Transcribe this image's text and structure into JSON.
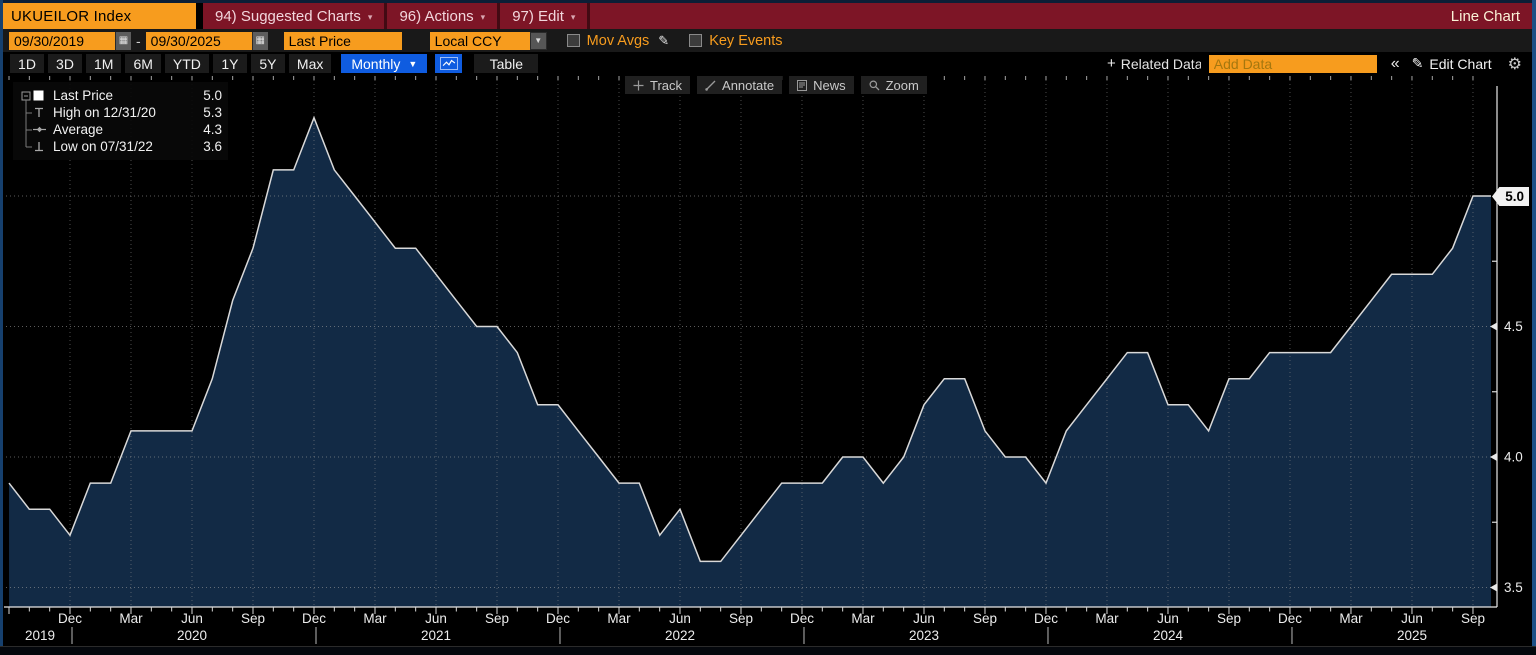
{
  "titlebar": {
    "ticker": "UKUEILOR Index",
    "menus": [
      {
        "label": "94) Suggested Charts"
      },
      {
        "label": "96) Actions"
      },
      {
        "label": "97) Edit"
      }
    ],
    "view_label": "Line Chart"
  },
  "controls": {
    "date_from": "09/30/2019",
    "range_separator": "-",
    "date_to": "09/30/2025",
    "security_field": "Last Price",
    "currency": "Local CCY",
    "mov_avgs_label": "Mov Avgs",
    "key_events_label": "Key Events"
  },
  "toolbar": {
    "ranges": [
      "1D",
      "3D",
      "1M",
      "6M",
      "YTD",
      "1Y",
      "5Y",
      "Max"
    ],
    "period": "Monthly",
    "table_label": "Table",
    "related_data_label": "Related Data",
    "add_data_placeholder": "Add Data",
    "edit_chart_label": "Edit Chart"
  },
  "chart_toolbar": {
    "buttons": [
      {
        "label": "Track"
      },
      {
        "label": "Annotate"
      },
      {
        "label": "News"
      },
      {
        "label": "Zoom"
      }
    ]
  },
  "legend": {
    "rows": [
      {
        "marker": "square",
        "label": "Last Price",
        "value": "5.0"
      },
      {
        "marker": "high",
        "label": "High on 12/31/20",
        "value": "5.3"
      },
      {
        "marker": "average",
        "label": "Average",
        "value": "4.3"
      },
      {
        "marker": "low",
        "label": "Low on 07/31/22",
        "value": "3.6"
      }
    ]
  },
  "y_axis": {
    "last_price_flag": "5.0",
    "tick_labels": [
      "4.5",
      "4.0",
      "3.5"
    ]
  },
  "icons": {
    "caret_small": "▾",
    "caret_down": "▼",
    "calendar": "▦",
    "pencil": "✎",
    "plus": "+",
    "collapse": "«",
    "gear": "⚙"
  },
  "colors": {
    "accent_orange": "#f79c1e",
    "titlebar_red": "#7d1526",
    "selected_blue": "#0f5ce0",
    "chart_fill": "#122a45",
    "chart_line": "#d9d9d9"
  },
  "chart_data": {
    "type": "area",
    "series_name": "Last Price",
    "frequency": "monthly",
    "start": "2019-09",
    "end": "2025-09",
    "values": [
      3.9,
      3.8,
      3.8,
      3.7,
      3.9,
      3.9,
      4.1,
      4.1,
      4.1,
      4.1,
      4.3,
      4.6,
      4.8,
      5.1,
      5.1,
      5.3,
      5.1,
      5.0,
      4.9,
      4.8,
      4.8,
      4.7,
      4.6,
      4.5,
      4.5,
      4.4,
      4.2,
      4.2,
      4.1,
      4.0,
      3.9,
      3.9,
      3.7,
      3.8,
      3.6,
      3.6,
      3.7,
      3.8,
      3.9,
      3.9,
      3.9,
      4.0,
      4.0,
      3.9,
      4.0,
      4.2,
      4.3,
      4.3,
      4.1,
      4.0,
      4.0,
      3.9,
      4.1,
      4.2,
      4.3,
      4.4,
      4.4,
      4.2,
      4.2,
      4.1,
      4.3,
      4.3,
      4.4,
      4.4,
      4.4,
      4.4,
      4.5,
      4.6,
      4.7,
      4.7,
      4.7,
      4.8,
      5.0
    ],
    "ylim": [
      3.45,
      5.45
    ],
    "yticks": [
      3.5,
      4.0,
      4.5,
      5.0
    ],
    "xtick_months": [
      "Dec",
      "Mar",
      "Jun",
      "Sep"
    ],
    "years": [
      "2019",
      "2020",
      "2021",
      "2022",
      "2023",
      "2024",
      "2025"
    ],
    "high": {
      "label": "High on 12/31/20",
      "value": 5.3
    },
    "low": {
      "label": "Low on 07/31/22",
      "value": 3.6
    },
    "average": 4.3,
    "last_price": 5.0,
    "grid": true,
    "legend_position": "top-left"
  }
}
